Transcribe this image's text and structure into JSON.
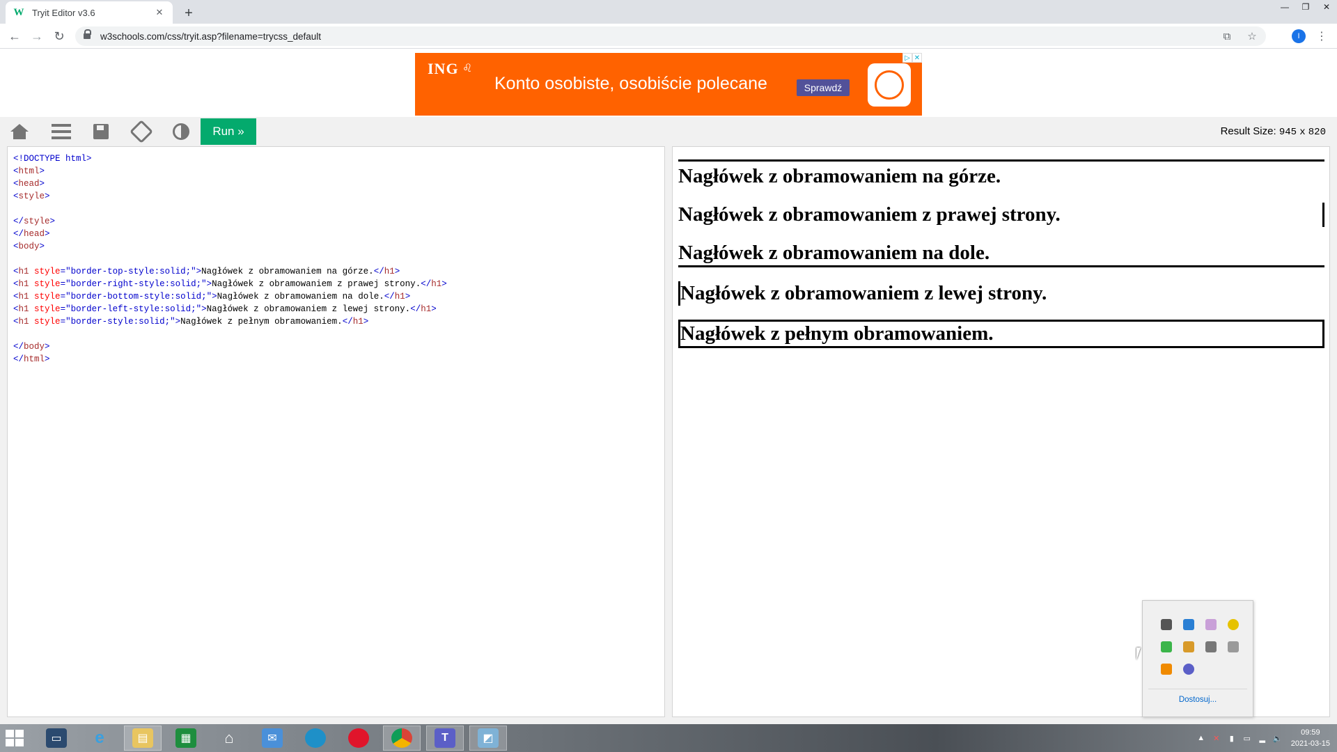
{
  "browser": {
    "tab_title": "Tryit Editor v3.6",
    "favicon": "W",
    "url": "w3schools.com/css/tryit.asp?filename=trycss_default",
    "profile_initial": "I"
  },
  "ad": {
    "brand": "ING",
    "headline": "Konto osobiste, osobiście polecane",
    "cta": "Sprawdź"
  },
  "toolbar": {
    "run_label": "Run »",
    "result_size_label": "Result Size:",
    "result_width": "945",
    "result_x": "x",
    "result_height": "820"
  },
  "code": {
    "doctype": "<!DOCTYPE html>",
    "h1_lines": [
      {
        "style": "border-top-style:solid;",
        "text": "Nagłówek z obramowaniem na górze."
      },
      {
        "style": "border-right-style:solid;",
        "text": "Nagłówek z obramowaniem z prawej strony."
      },
      {
        "style": "border-bottom-style:solid;",
        "text": "Nagłówek z obramowaniem na dole."
      },
      {
        "style": "border-left-style:solid;",
        "text": "Nagłówek z obramowaniem z lewej strony."
      },
      {
        "style": "border-style:solid;",
        "text": "Nagłówek z pełnym obramowaniem."
      }
    ]
  },
  "result": {
    "headings": [
      "Nagłówek z obramowaniem na górze.",
      "Nagłówek z obramowaniem z prawej strony.",
      "Nagłówek z obramowaniem na dole.",
      "Nagłówek z obramowaniem z lewej strony.",
      "Nagłówek z pełnym obramowaniem."
    ]
  },
  "tray_popup": {
    "customize_link": "Dostosuj..."
  },
  "taskbar": {
    "time": "09:59",
    "date": "2021-03-15"
  },
  "colors": {
    "run_green": "#04aa6d",
    "ad_orange": "#ff6200",
    "ad_cta": "#525199"
  }
}
